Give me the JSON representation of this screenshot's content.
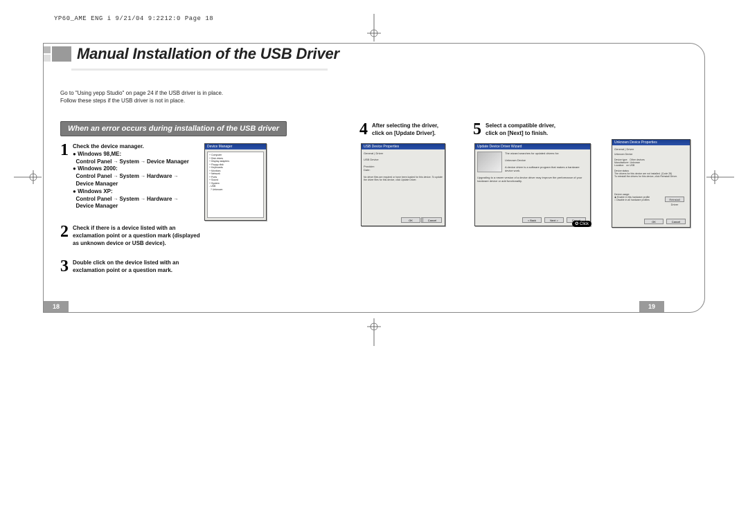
{
  "header": "YP60_AME ENG i  9/21/04 9:2212:0  Page 18",
  "title": "Manual Installation of the USB Driver",
  "intro_line1": "Go to \"Using yepp Studio\" on page 24 if the USB driver is in place.",
  "intro_line2": "Follow these steps if the USB driver is not in place.",
  "section_header": "When an error occurs during installation of the USB driver",
  "steps": {
    "s1": {
      "num": "1",
      "lead": "Check the device manager.",
      "os1_label": "Windows 98,ME:",
      "os1_path_a": "Control Panel",
      "os1_path_b": "System",
      "os1_path_c": "Device Manager",
      "os2_label": "Windows 2000:",
      "os2_path_a": "Control Panel",
      "os2_path_b": "System",
      "os2_path_c": "Hardware",
      "os2_path_d": "Device Manager",
      "os3_label": "Windows XP:",
      "os3_path_a": "Control Panel",
      "os3_path_b": "System",
      "os3_path_c": "Hardware",
      "os3_path_d": "Device Manager"
    },
    "s2": {
      "num": "2",
      "text": "Check if there is a device listed with an exclamation point or a question mark (displayed as unknown device or USB device)."
    },
    "s3": {
      "num": "3",
      "text": "Double click on the device listed with an exclamation point or a question mark."
    },
    "s4": {
      "num": "4",
      "line1": "After selecting the driver,",
      "line2": "click on [Update Driver]."
    },
    "s5": {
      "num": "5",
      "line1": "Select a compatible driver,",
      "line2": "click on [Next] to finish."
    }
  },
  "screenshots": {
    "dm": {
      "title": "Device Manager"
    },
    "props": {
      "title": "USB Device Properties",
      "ok": "OK",
      "cancel": "Cancel"
    },
    "wizard": {
      "title": "Update Device Driver Wizard",
      "back": "< Back",
      "next": "Next >",
      "cancel": "Cancel",
      "click": "Click"
    },
    "unknown": {
      "title": "Unknown Device Properties",
      "ok": "OK",
      "cancel": "Cancel",
      "reinstall": "Reinstall Driver"
    }
  },
  "page_left": "18",
  "page_right": "19"
}
